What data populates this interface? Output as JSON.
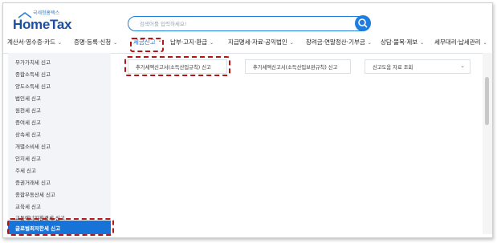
{
  "header": {
    "logo_sub": "국세청홈택스",
    "logo_main": "HomeTax",
    "search_placeholder": "검색어를 입력하세요!"
  },
  "nav": {
    "items": [
      {
        "label": "계산서·영수증·카드"
      },
      {
        "label": "증명·등록·신청"
      },
      {
        "label": "세금신고"
      },
      {
        "label": "납부·고지·환급"
      },
      {
        "label": "지급명세·자료·공익법인"
      },
      {
        "label": "장려금·연말정산·기부금"
      },
      {
        "label": "상담·불복·제보"
      },
      {
        "label": "세무대리·납세관리"
      }
    ]
  },
  "sidebar": {
    "items": [
      {
        "label": "부가가치세 신고"
      },
      {
        "label": "종합소득세 신고"
      },
      {
        "label": "양도소득세 신고"
      },
      {
        "label": "법인세 신고"
      },
      {
        "label": "원천세 신고"
      },
      {
        "label": "증여세 신고"
      },
      {
        "label": "상속세 신고"
      },
      {
        "label": "개별소비세 신고"
      },
      {
        "label": "인지세 신고"
      },
      {
        "label": "주세 신고"
      },
      {
        "label": "증권거래세 신고"
      },
      {
        "label": "종합부동산세 신고"
      },
      {
        "label": "교육세 신고"
      },
      {
        "label": "교통에너지환경세 신고"
      }
    ],
    "active_label": "글로벌최저한세 신고"
  },
  "content": {
    "cards": [
      {
        "label": "추가세액신고서(소득산입규칙) 신고"
      },
      {
        "label": "추가세액신고서(소득산입보완규칙) 신고"
      },
      {
        "label": "신고도움 자료 조회"
      }
    ]
  }
}
